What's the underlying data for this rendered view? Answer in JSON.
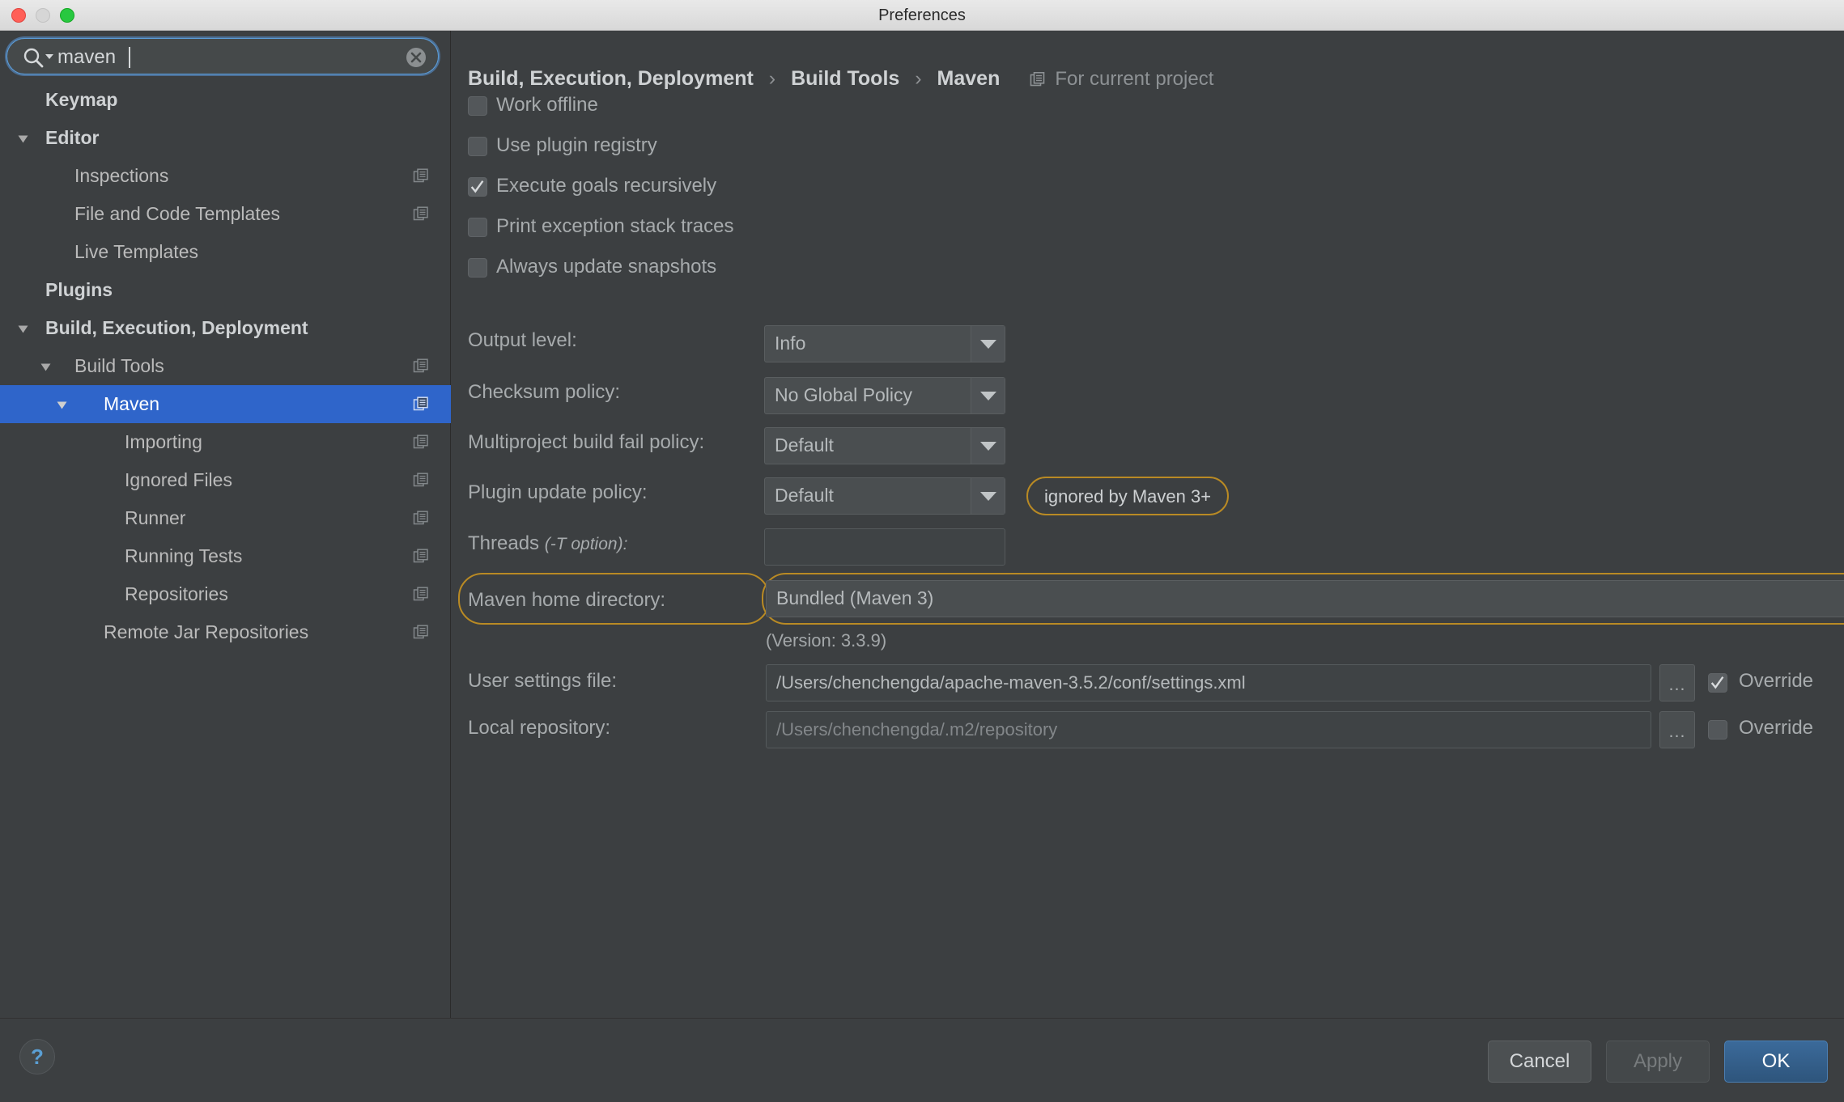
{
  "window": {
    "title": "Preferences",
    "traffic_lights": [
      "close-red",
      "minimize-gray",
      "zoom-green"
    ]
  },
  "search": {
    "value": "maven",
    "placeholder": "",
    "icon": "search-icon",
    "clear_icon": "clear-circle-icon"
  },
  "sidebar": {
    "items": [
      {
        "label": "Keymap",
        "indent": 0,
        "bold": true,
        "arrow": "none",
        "badge": false,
        "selected": false
      },
      {
        "label": "Editor",
        "indent": 0,
        "bold": true,
        "arrow": "expanded",
        "badge": false,
        "selected": false
      },
      {
        "label": "Inspections",
        "indent": 1,
        "bold": false,
        "arrow": "none",
        "badge": true,
        "selected": false
      },
      {
        "label": "File and Code Templates",
        "indent": 1,
        "bold": false,
        "arrow": "none",
        "badge": true,
        "selected": false
      },
      {
        "label": "Live Templates",
        "indent": 1,
        "bold": false,
        "arrow": "none",
        "badge": false,
        "selected": false
      },
      {
        "label": "Plugins",
        "indent": 0,
        "bold": true,
        "arrow": "none",
        "badge": false,
        "selected": false
      },
      {
        "label": "Build, Execution, Deployment",
        "indent": 0,
        "bold": true,
        "arrow": "expanded",
        "badge": false,
        "selected": false
      },
      {
        "label": "Build Tools",
        "indent": 1,
        "bold": false,
        "arrow": "expanded",
        "badge": true,
        "selected": false
      },
      {
        "label": "Maven",
        "indent": 2,
        "bold": false,
        "arrow": "expanded",
        "badge": true,
        "selected": true
      },
      {
        "label": "Importing",
        "indent": 3,
        "bold": false,
        "arrow": "none",
        "badge": true,
        "selected": false
      },
      {
        "label": "Ignored Files",
        "indent": 3,
        "bold": false,
        "arrow": "none",
        "badge": true,
        "selected": false
      },
      {
        "label": "Runner",
        "indent": 3,
        "bold": false,
        "arrow": "none",
        "badge": true,
        "selected": false
      },
      {
        "label": "Running Tests",
        "indent": 3,
        "bold": false,
        "arrow": "none",
        "badge": true,
        "selected": false
      },
      {
        "label": "Repositories",
        "indent": 3,
        "bold": false,
        "arrow": "none",
        "badge": true,
        "selected": false
      },
      {
        "label": "Remote Jar Repositories",
        "indent": 2,
        "bold": false,
        "arrow": "none",
        "badge": true,
        "selected": false
      }
    ]
  },
  "breadcrumb": {
    "segments": [
      "Build, Execution, Deployment",
      "Build Tools",
      "Maven"
    ],
    "separator": "›",
    "project_scope": "For current project",
    "project_scope_icon": "project-scope-icon"
  },
  "checkboxes": [
    {
      "label": "Work offline",
      "checked": false
    },
    {
      "label": "Use plugin registry",
      "checked": false
    },
    {
      "label": "Execute goals recursively",
      "checked": true
    },
    {
      "label": "Print exception stack traces",
      "checked": false
    },
    {
      "label": "Always update snapshots",
      "checked": false
    }
  ],
  "fields": {
    "output_level": {
      "label": "Output level:",
      "value": "Info"
    },
    "checksum_policy": {
      "label": "Checksum policy:",
      "value": "No Global Policy"
    },
    "multiproject": {
      "label": "Multiproject build fail policy:",
      "value": "Default"
    },
    "plugin_update": {
      "label": "Plugin update policy:",
      "value": "Default",
      "badge": "ignored by Maven 3+"
    },
    "threads": {
      "label": "Threads ",
      "label_italic": "(-T option):",
      "value": ""
    },
    "maven_home": {
      "label": "Maven home directory:",
      "value": "Bundled (Maven 3)",
      "version_note": "(Version: 3.3.9)"
    },
    "user_settings": {
      "label": "User settings file:",
      "value": "/Users/chenchengda/apache-maven-3.5.2/conf/settings.xml",
      "override_label": "Override",
      "override_checked": true,
      "dim": false
    },
    "local_repository": {
      "label": "Local repository:",
      "value": "/Users/chenchengda/.m2/repository",
      "override_label": "Override",
      "override_checked": false,
      "dim": true
    }
  },
  "footer": {
    "help_label": "?",
    "cancel_label": "Cancel",
    "apply_label": "Apply",
    "ok_label": "OK"
  },
  "colors": {
    "accent_selection": "#2f65ca",
    "highlight_outline": "#b98a24",
    "panel_bg": "#3c3f41",
    "ok_button": "#3b6a9a"
  }
}
